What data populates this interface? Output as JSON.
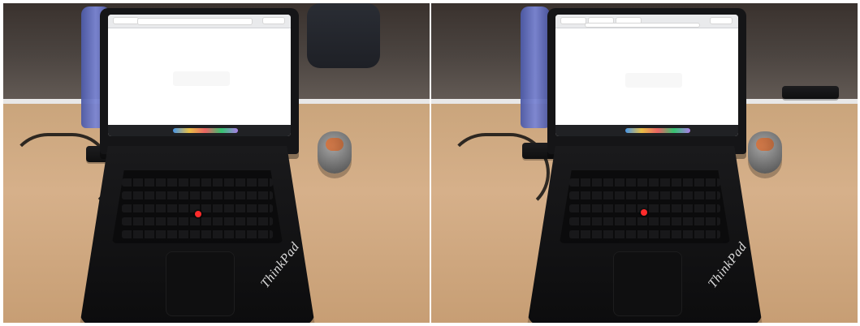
{
  "panels": [
    {
      "id": "left",
      "brand_text": "ThinkPad"
    },
    {
      "id": "right",
      "brand_text": "ThinkPad"
    }
  ]
}
